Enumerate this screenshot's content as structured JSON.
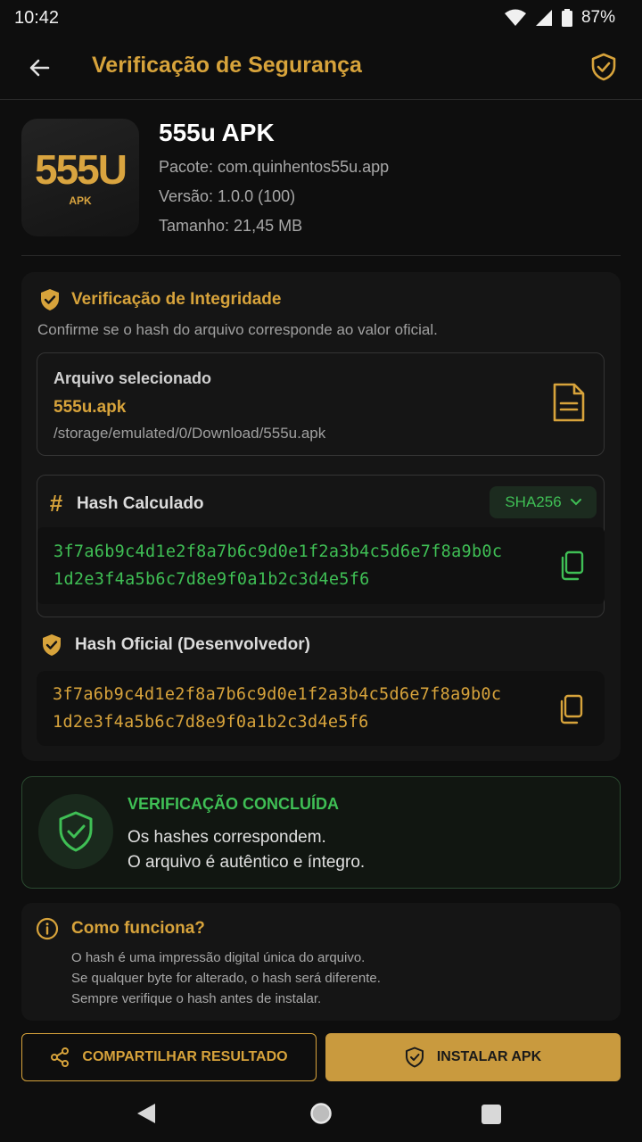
{
  "status_bar": {
    "time": "10:42",
    "battery": "87%"
  },
  "app_bar": {
    "title": "Verificação de Segurança"
  },
  "app_info": {
    "logo_text": "555U",
    "logo_sub": "APK",
    "name": "555u APK",
    "package": "Pacote: com.quinhentos55u.app",
    "version": "Versão: 1.0.0 (100)",
    "size": "Tamanho: 21,45 MB"
  },
  "integrity": {
    "title": "Verificação de Integridade",
    "description": "Confirme se o hash do arquivo corresponde ao valor oficial.",
    "file": {
      "label": "Arquivo selecionado",
      "name": "555u.apk",
      "path": "/storage/emulated/0/Download/555u.apk"
    },
    "calculated": {
      "label": "Hash Calculado",
      "algorithm": "SHA256",
      "line1": "3f7a6b9c4d1e2f8a7b6c9d0e1f2a3b4c5d6e7f8a9b0c",
      "line2": "1d2e3f4a5b6c7d8e9f0a1b2c3d4e5f6"
    },
    "official": {
      "label": "Hash Oficial (Desenvolvedor)",
      "line1": "3f7a6b9c4d1e2f8a7b6c9d0e1f2a3b4c5d6e7f8a9b0c",
      "line2": "1d2e3f4a5b6c7d8e9f0a1b2c3d4e5f6"
    }
  },
  "result": {
    "title": "VERIFICAÇÃO CONCLUÍDA",
    "line1": "Os hashes correspondem.",
    "line2": "O arquivo é autêntico e íntegro."
  },
  "how_it_works": {
    "title": "Como funciona?",
    "lines": [
      "O hash é uma impressão digital única do arquivo.",
      "Se qualquer byte for alterado, o hash será diferente.",
      "Sempre verifique o hash antes de instalar."
    ]
  },
  "buttons": {
    "share": "COMPARTILHAR RESULTADO",
    "install": "INSTALAR APK"
  },
  "colors": {
    "accent": "#d7a33b",
    "success": "#3fbf55",
    "background": "#0e0e0e"
  }
}
